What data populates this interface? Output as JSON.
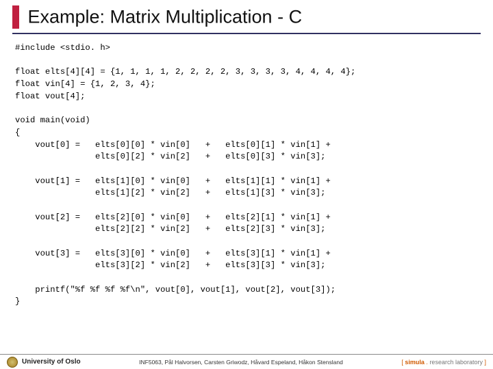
{
  "title": "Example: Matrix Multiplication - C",
  "code": "#include <stdio. h>\n\nfloat elts[4][4] = {1, 1, 1, 1, 2, 2, 2, 2, 3, 3, 3, 3, 4, 4, 4, 4};\nfloat vin[4] = {1, 2, 3, 4};\nfloat vout[4];\n\nvoid main(void)\n{\n    vout[0] =   elts[0][0] * vin[0]   +   elts[0][1] * vin[1] +\n                elts[0][2] * vin[2]   +   elts[0][3] * vin[3];\n\n    vout[1] =   elts[1][0] * vin[0]   +   elts[1][1] * vin[1] +\n                elts[1][2] * vin[2]   +   elts[1][3] * vin[3];\n\n    vout[2] =   elts[2][0] * vin[0]   +   elts[2][1] * vin[1] +\n                elts[2][2] * vin[2]   +   elts[2][3] * vin[3];\n\n    vout[3] =   elts[3][0] * vin[0]   +   elts[3][1] * vin[1] +\n                elts[3][2] * vin[2]   +   elts[3][3] * vin[3];\n\n    printf(\"%f %f %f %f\\n\", vout[0], vout[1], vout[2], vout[3]);\n}",
  "footer": {
    "left": "University of Oslo",
    "mid": "INF5063, Pål Halvorsen, Carsten Griwodz, Håvard Espeland, Håkon Stensland",
    "brand_open": "[ ",
    "brand_name": "simula",
    "brand_dot": " . ",
    "brand_rl": "research laboratory",
    "brand_close": " ]"
  }
}
